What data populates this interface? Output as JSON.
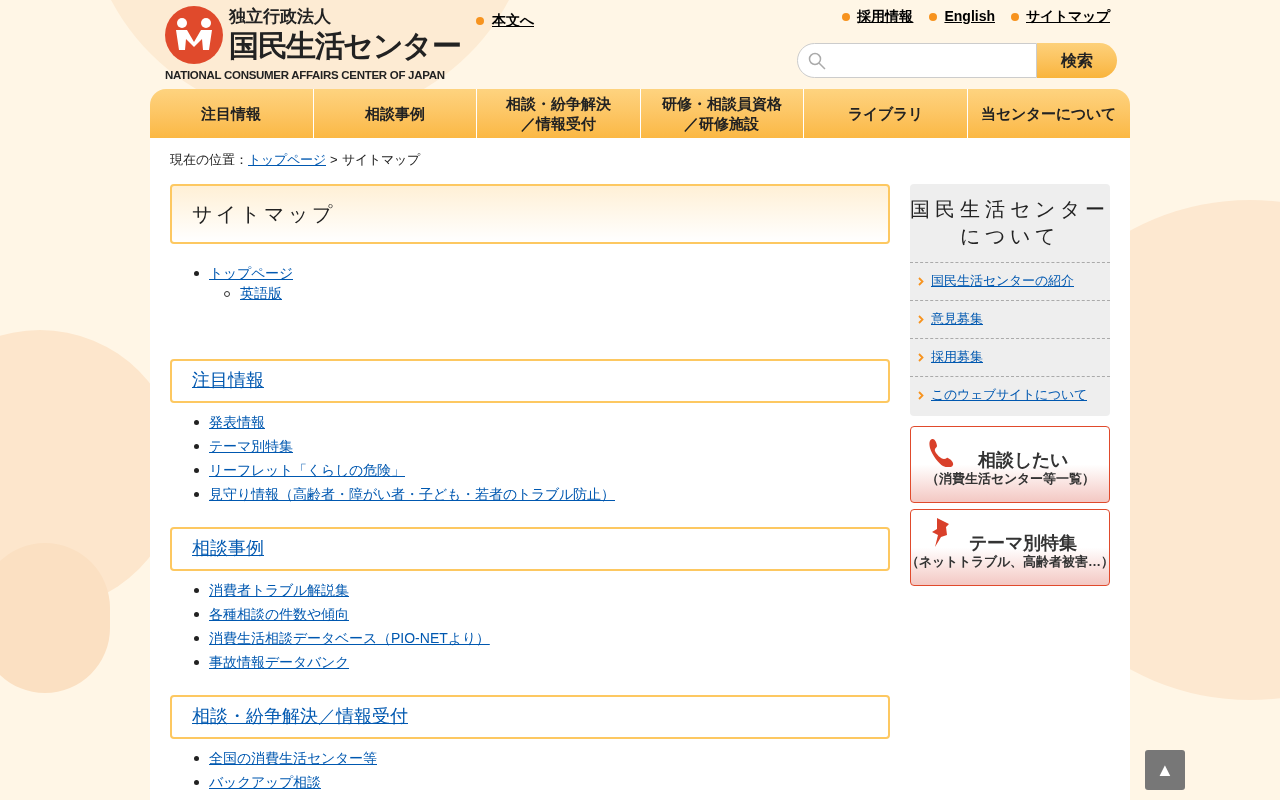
{
  "header": {
    "logo": {
      "small": "独立行政法人",
      "main": "国民生活センター",
      "english": "NATIONAL CONSUMER AFFAIRS CENTER OF JAPAN"
    },
    "skip_link": "本文へ",
    "utility_links": [
      "採用情報",
      "English",
      "サイトマップ"
    ],
    "search": {
      "button": "検索"
    }
  },
  "nav": [
    {
      "label": "注目情報"
    },
    {
      "label": "相談事例"
    },
    {
      "lines": [
        "相談・紛争解決",
        "／情報受付"
      ]
    },
    {
      "lines": [
        "研修・相談員資格",
        "／研修施設"
      ]
    },
    {
      "label": "ライブラリ"
    },
    {
      "label": "当センターについて"
    }
  ],
  "breadcrumb": {
    "prefix": "現在の位置：",
    "link": "トップページ",
    "separator": ">",
    "current": "サイトマップ"
  },
  "page_title": "サイトマップ",
  "top_list": [
    {
      "label": "トップページ",
      "children": [
        {
          "label": "英語版"
        }
      ]
    }
  ],
  "sections": [
    {
      "heading": "注目情報",
      "items": [
        "発表情報",
        "テーマ別特集",
        "リーフレット「くらしの危険」",
        "見守り情報（高齢者・障がい者・子ども・若者のトラブル防止）"
      ]
    },
    {
      "heading": "相談事例",
      "items": [
        "消費者トラブル解説集",
        "各種相談の件数や傾向",
        "消費生活相談データベース（PIO-NETより）",
        "事故情報データバンク"
      ]
    },
    {
      "heading": "相談・紛争解決／情報受付",
      "items": [
        "全国の消費生活センター等",
        "バックアップ相談"
      ]
    }
  ],
  "sidebar": {
    "title_lines": [
      "国民生活センター",
      "について"
    ],
    "links": [
      "国民生活センターの紹介",
      "意見募集",
      "採用募集",
      "このウェブサイトについて"
    ],
    "banners": [
      {
        "kind": "phone",
        "title": "相談したい",
        "subtitle": "（消費生活センター等一覧）"
      },
      {
        "kind": "pin",
        "title": "テーマ別特集",
        "subtitle": "（ネットトラブル、高齢者被害…）"
      }
    ]
  },
  "back_to_top": "▲"
}
